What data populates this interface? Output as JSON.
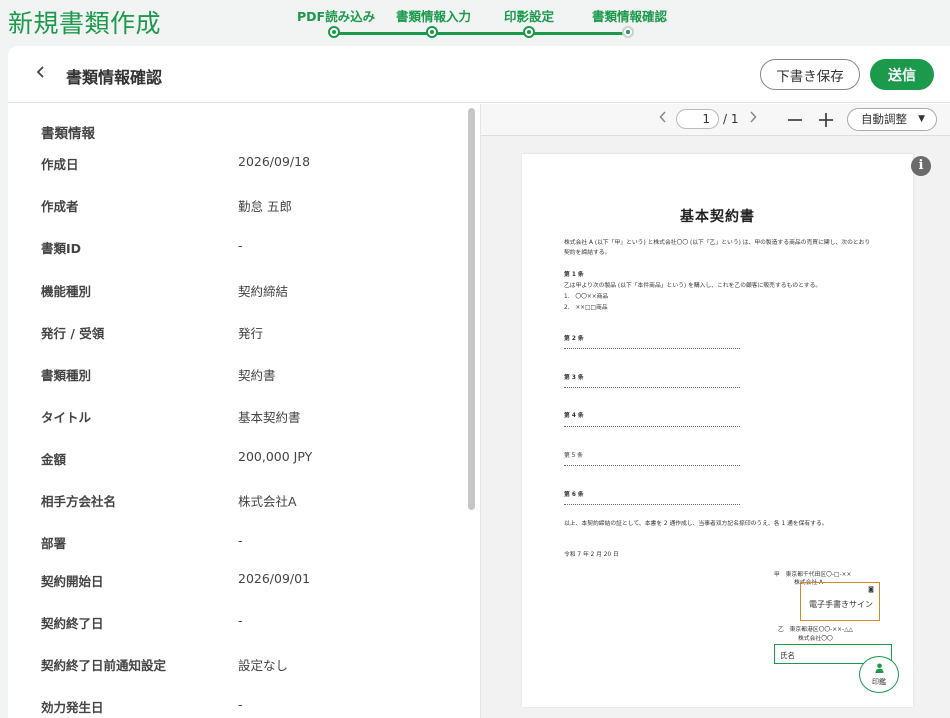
{
  "app": {
    "title": "新規書類作成"
  },
  "steps": [
    {
      "label": "PDF読み込み"
    },
    {
      "label": "書類情報入力"
    },
    {
      "label": "印影設定"
    },
    {
      "label": "書類情報確認"
    }
  ],
  "header": {
    "back_icon": "chevron-left",
    "title": "書類情報確認",
    "draft_label": "下書き保存",
    "send_label": "送信"
  },
  "info": {
    "section_title": "書類情報",
    "rows": [
      {
        "key": "作成日",
        "value": "2026/09/18"
      },
      {
        "key": "作成者",
        "value": "勤怠 五郎"
      },
      {
        "key": "書類ID",
        "value": "-"
      },
      {
        "key": "機能種別",
        "value": "契約締結"
      },
      {
        "key": "発行 / 受領",
        "value": "発行"
      },
      {
        "key": "書類種別",
        "value": "契約書"
      },
      {
        "key": "タイトル",
        "value": "基本契約書"
      },
      {
        "key": "金額",
        "value": "200,000 JPY"
      },
      {
        "key": "相手方会社名",
        "value": "株式会社A"
      },
      {
        "key": "部署",
        "value": "-"
      },
      {
        "key": "契約開始日",
        "value": "2026/09/01"
      },
      {
        "key": "契約終了日",
        "value": "-"
      },
      {
        "key": "契約終了日前通知設定",
        "value": "設定なし"
      },
      {
        "key": "効力発生日",
        "value": "-"
      }
    ]
  },
  "viewer": {
    "page_current": "1",
    "page_total": "/ 1",
    "zoom_label": "自動調整",
    "document": {
      "title": "基本契約書",
      "intro1": "株式会社 A (以下「甲」という) と株式会社〇〇 (以下「乙」という) は、甲の製造する商品の売買に関し、次のとおり",
      "intro2": "契約を締結する。",
      "art1": "第 1 条",
      "art1_text": "乙は甲より次の製品 (以下「本件商品」という) を購入し、これを乙の顧客に販売するものとする。",
      "item1": "1.　〇〇××商品",
      "item2": "2.　××□□商品",
      "art2": "第 2 条",
      "art3": "第 3 条",
      "art4": "第 4 条",
      "art5": "第 5 条",
      "art6": "第 6 条",
      "closing": "以上、本契約締結の証として、本書を 2 通作成し、当事者双方記名捺印のうえ、各 1 通を保有する。",
      "date": "令和 7 年 2 月 20 日",
      "party_a": "甲　東京都千代田区〇-□-××",
      "party_a_co": "株式会社 A",
      "party_b": "乙　東京都港区〇〇-××-△△",
      "party_b_co": "株式会社〇〇",
      "sign_label": "電子手書きサイン",
      "name_label": "氏名",
      "seal_label": "印鑑"
    }
  },
  "colors": {
    "accent": "#1b9a4c",
    "sign_border": "#d08a2e"
  }
}
